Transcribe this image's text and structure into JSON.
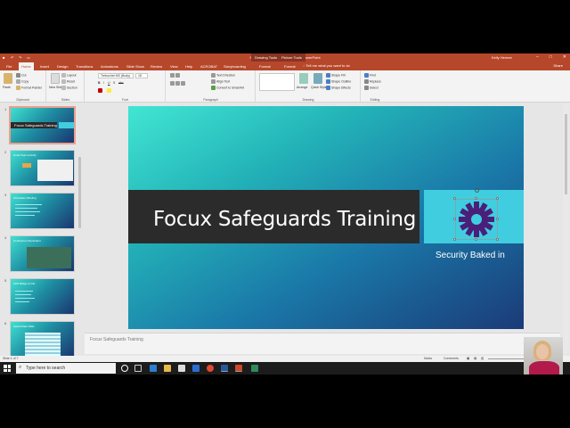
{
  "window": {
    "doc_title": "SC_PPT19_3b_KellyHenner_2 - PowerPoint",
    "context_tabs": [
      "Drawing Tools",
      "Picture Tools"
    ],
    "user": "Kelly Henner"
  },
  "tabs": [
    "File",
    "Home",
    "Insert",
    "Design",
    "Transitions",
    "Animations",
    "Slide Show",
    "Review",
    "View",
    "Help",
    "ACROBAT",
    "Storyboarding",
    "Format",
    "Format"
  ],
  "tell_me": "Tell me what you want to do",
  "share": "Share",
  "ribbon": {
    "clipboard": {
      "paste": "Paste",
      "cut": "Cut",
      "copy": "Copy",
      "format_painter": "Format Painter",
      "label": "Clipboard"
    },
    "slides": {
      "new_slide": "New Slide",
      "layout": "Layout",
      "reset": "Reset",
      "section": "Section",
      "label": "Slides"
    },
    "font": {
      "name": "Trebuchet MS (Body)",
      "size": "18",
      "label": "Font"
    },
    "paragraph": {
      "text_direction": "Text Direction",
      "align_text": "Align Text",
      "convert_smartart": "Convert to SmartArt",
      "label": "Paragraph"
    },
    "drawing": {
      "arrange": "Arrange",
      "quick_styles": "Quick Styles",
      "shape_fill": "Shape Fill",
      "shape_outline": "Shape Outline",
      "shape_effects": "Shape Effects",
      "label": "Drawing"
    },
    "editing": {
      "find": "Find",
      "replace": "Replace",
      "select": "Select",
      "label": "Editing"
    }
  },
  "thumbnails": [
    {
      "num": "1",
      "title": "Focux Safeguards Training"
    },
    {
      "num": "2",
      "title": "Small Team Activity"
    },
    {
      "num": "3",
      "title": "Orientation Briefing"
    },
    {
      "num": "4",
      "title": "Conference Reminders"
    },
    {
      "num": "5",
      "title": "AHS Badge & Info"
    },
    {
      "num": "6",
      "title": "Award Data Table"
    }
  ],
  "slide": {
    "title": "Focux Safeguards Training",
    "subtitle": "Security Baked in"
  },
  "notes_placeholder": "Focux Safeguards Training",
  "status": {
    "slide_info": "Slide 1 of 7",
    "notes": "Notes",
    "comments": "Comments"
  },
  "taskbar": {
    "search_placeholder": "Type here to search"
  },
  "colors": {
    "accent": "#b7472a",
    "slide_teal": "#41e6d3",
    "slide_navy": "#1b3b78",
    "gear": "#4a1f7a"
  }
}
